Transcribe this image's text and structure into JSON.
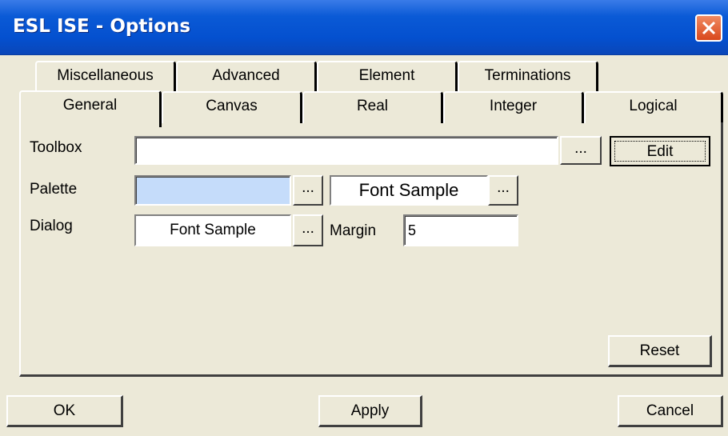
{
  "window": {
    "title": "ESL ISE - Options"
  },
  "tabs_back": [
    "Miscellaneous",
    "Advanced",
    "Element",
    "Terminations"
  ],
  "tabs_front": [
    "General",
    "Canvas",
    "Real",
    "Integer",
    "Logical"
  ],
  "active_tab": "General",
  "general": {
    "toolbox_label": "Toolbox",
    "toolbox_value": "",
    "browse": "...",
    "edit_label": "Edit",
    "palette_label": "Palette",
    "palette_color": "#c5dcfa",
    "palette_font_sample": "Font Sample",
    "dialog_label": "Dialog",
    "dialog_font_sample": "Font Sample",
    "margin_label": "Margin",
    "margin_value": "5",
    "reset_label": "Reset"
  },
  "footer": {
    "ok": "OK",
    "apply": "Apply",
    "cancel": "Cancel"
  }
}
